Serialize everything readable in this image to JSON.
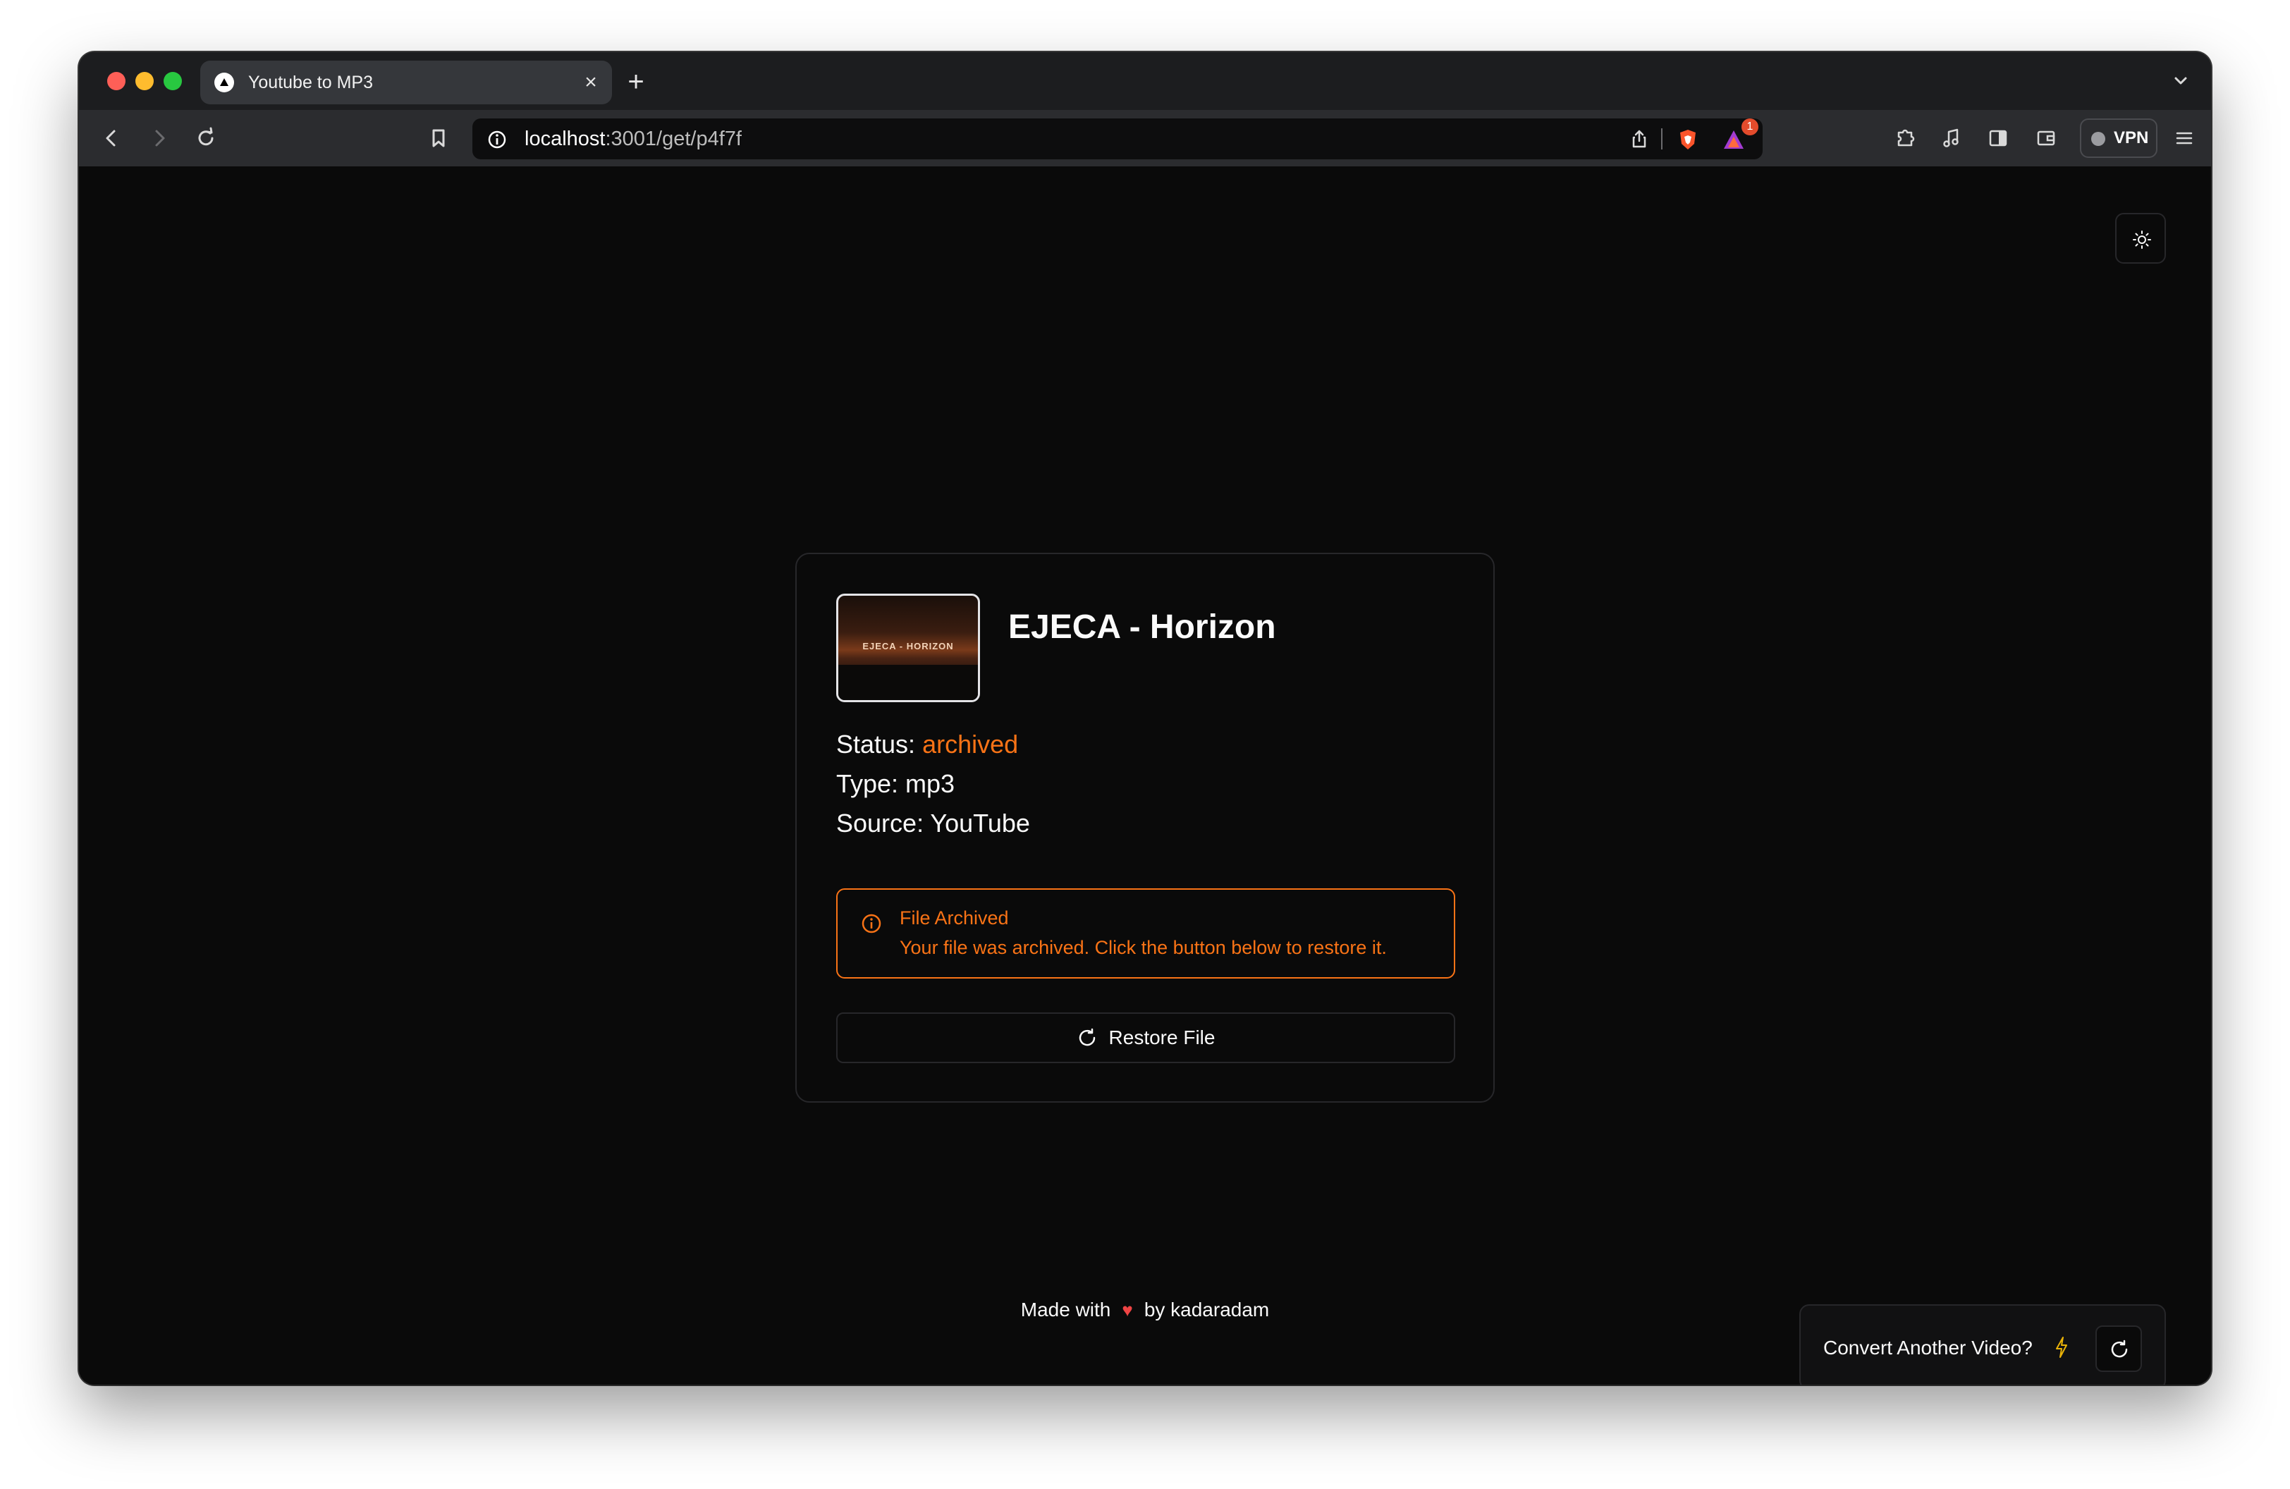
{
  "browser": {
    "tab": {
      "title": "Youtube to MP3",
      "close_glyph": "×"
    },
    "new_tab_glyph": "+",
    "address": {
      "host": "localhost",
      "path": ":3001/get/p4f7f"
    },
    "notification_count": "1",
    "vpn_label": "VPN"
  },
  "card": {
    "thumbnail_text": "EJECA - HORIZON",
    "title": "EJECA - Horizon",
    "status_label": "Status: ",
    "status_value": "archived",
    "type_line": "Type: mp3",
    "source_line": "Source: YouTube",
    "alert": {
      "title": "File Archived",
      "description": "Your file was archived. Click the button below to restore it."
    },
    "restore_label": "Restore File"
  },
  "footer": {
    "prefix": "Made with",
    "heart": "♥",
    "suffix": "by kadaradam"
  },
  "toast": {
    "text": "Convert Another Video?"
  },
  "colors": {
    "background": "#0a0a0a",
    "accent_orange": "#f97316",
    "heart_red": "#ef4444",
    "border": "#27272a"
  }
}
